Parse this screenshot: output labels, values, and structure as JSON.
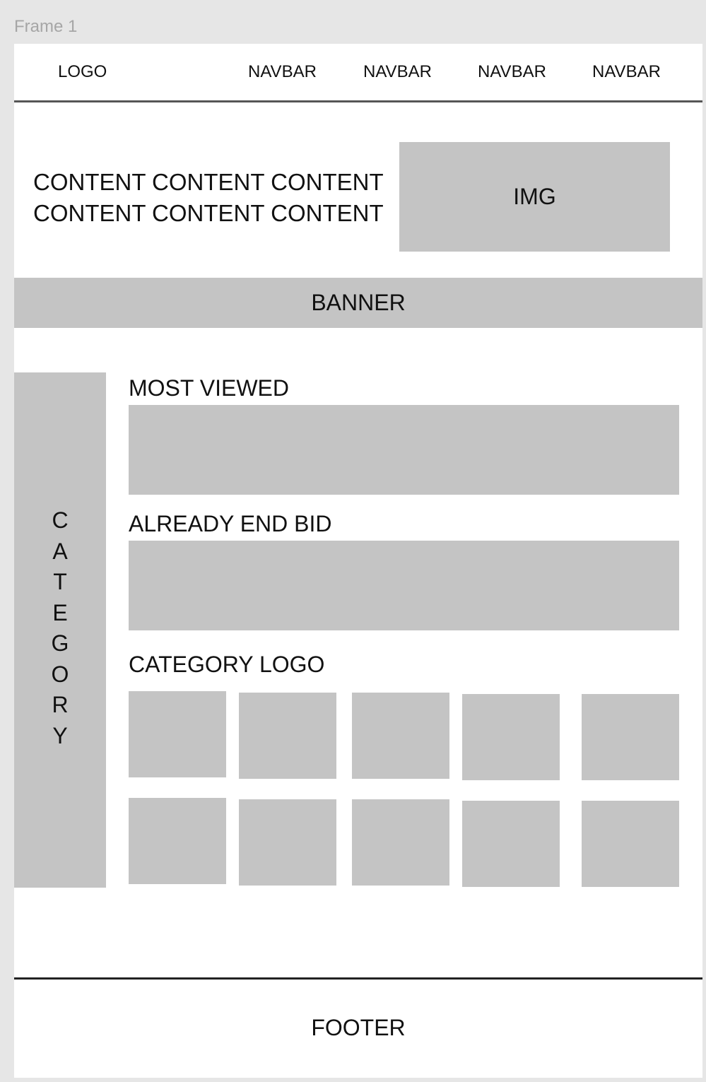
{
  "frame": {
    "title": "Frame 1"
  },
  "header": {
    "logo": "LOGO",
    "nav": [
      "NAVBAR",
      "NAVBAR",
      "NAVBAR",
      "NAVBAR"
    ]
  },
  "hero": {
    "text_line1": "CONTENT CONTENT CONTENT",
    "text_line2": "CONTENT CONTENT CONTENT",
    "img_label": "IMG"
  },
  "banner": {
    "label": "BANNER"
  },
  "sidebar": {
    "label": "C\nA\nT\nE\nG\nO\nR\nY"
  },
  "sections": {
    "most_viewed": "MOST VIEWED",
    "already_end_bid": "ALREADY END BID",
    "category_logo": "CATEGORY LOGO"
  },
  "footer": {
    "label": "FOOTER"
  },
  "colors": {
    "placeholder": "#c4c4c4",
    "canvas": "#e6e6e6",
    "frame": "#ffffff"
  }
}
